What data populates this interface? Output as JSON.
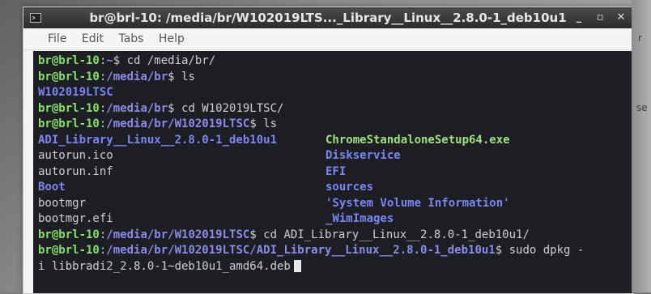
{
  "window": {
    "title": "br@brl-10: /media/br/W102019LTS..._Library__Linux__2.8.0-1_deb10u1",
    "controls": [
      "_",
      "▫",
      "✕"
    ]
  },
  "menu": [
    "File",
    "Edit",
    "Tabs",
    "Help"
  ],
  "terminal": {
    "lines": [
      {
        "user": "br@brl-10",
        "sep": ":",
        "path": "~",
        "rest": "$ cd /media/br/"
      },
      {
        "user": "br@brl-10",
        "sep": ":",
        "path": "/media/br",
        "rest": "$ ls"
      },
      {
        "output": "W102019LTSC",
        "style": "dir"
      },
      {
        "user": "br@brl-10",
        "sep": ":",
        "path": "/media/br",
        "rest": "$ cd W102019LTSC/"
      },
      {
        "user": "br@brl-10",
        "sep": ":",
        "path": "/media/br/W102019LTSC",
        "rest": "$ ls"
      }
    ],
    "listing": [
      {
        "left": "ADI_Library__Linux__2.8.0-1_deb10u1",
        "left_style": "dir",
        "right": "ChromeStandaloneSetup64.exe",
        "right_style": "green"
      },
      {
        "left": "autorun.ico",
        "left_style": "file",
        "right": "Diskservice",
        "right_style": "dir"
      },
      {
        "left": "autorun.inf",
        "left_style": "file",
        "right": "EFI",
        "right_style": "dir"
      },
      {
        "left": "Boot",
        "left_style": "dir",
        "right": "sources",
        "right_style": "dir"
      },
      {
        "left": "bootmgr",
        "left_style": "file",
        "right": "'System Volume Information'",
        "right_style": "dir"
      },
      {
        "left": "bootmgr.efi",
        "left_style": "file",
        "right": "_WimImages",
        "right_style": "dir"
      }
    ],
    "after": [
      {
        "user": "br@brl-10",
        "sep": ":",
        "path": "/media/br/W102019LTSC",
        "rest": "$ cd ADI_Library__Linux__2.8.0-1_deb10u1/"
      },
      {
        "user": "br@brl-10",
        "sep": ":",
        "path": "/media/br/W102019LTSC/ADI_Library__Linux__2.8.0-1_deb10u1",
        "rest": "$ sudo dpkg -"
      },
      {
        "output": "i libbradi2_2.8.0-1~deb10u1_amd64.deb",
        "style": "file",
        "cursor": true
      }
    ]
  },
  "edge": {
    "text1": "r",
    "text2": "se"
  }
}
